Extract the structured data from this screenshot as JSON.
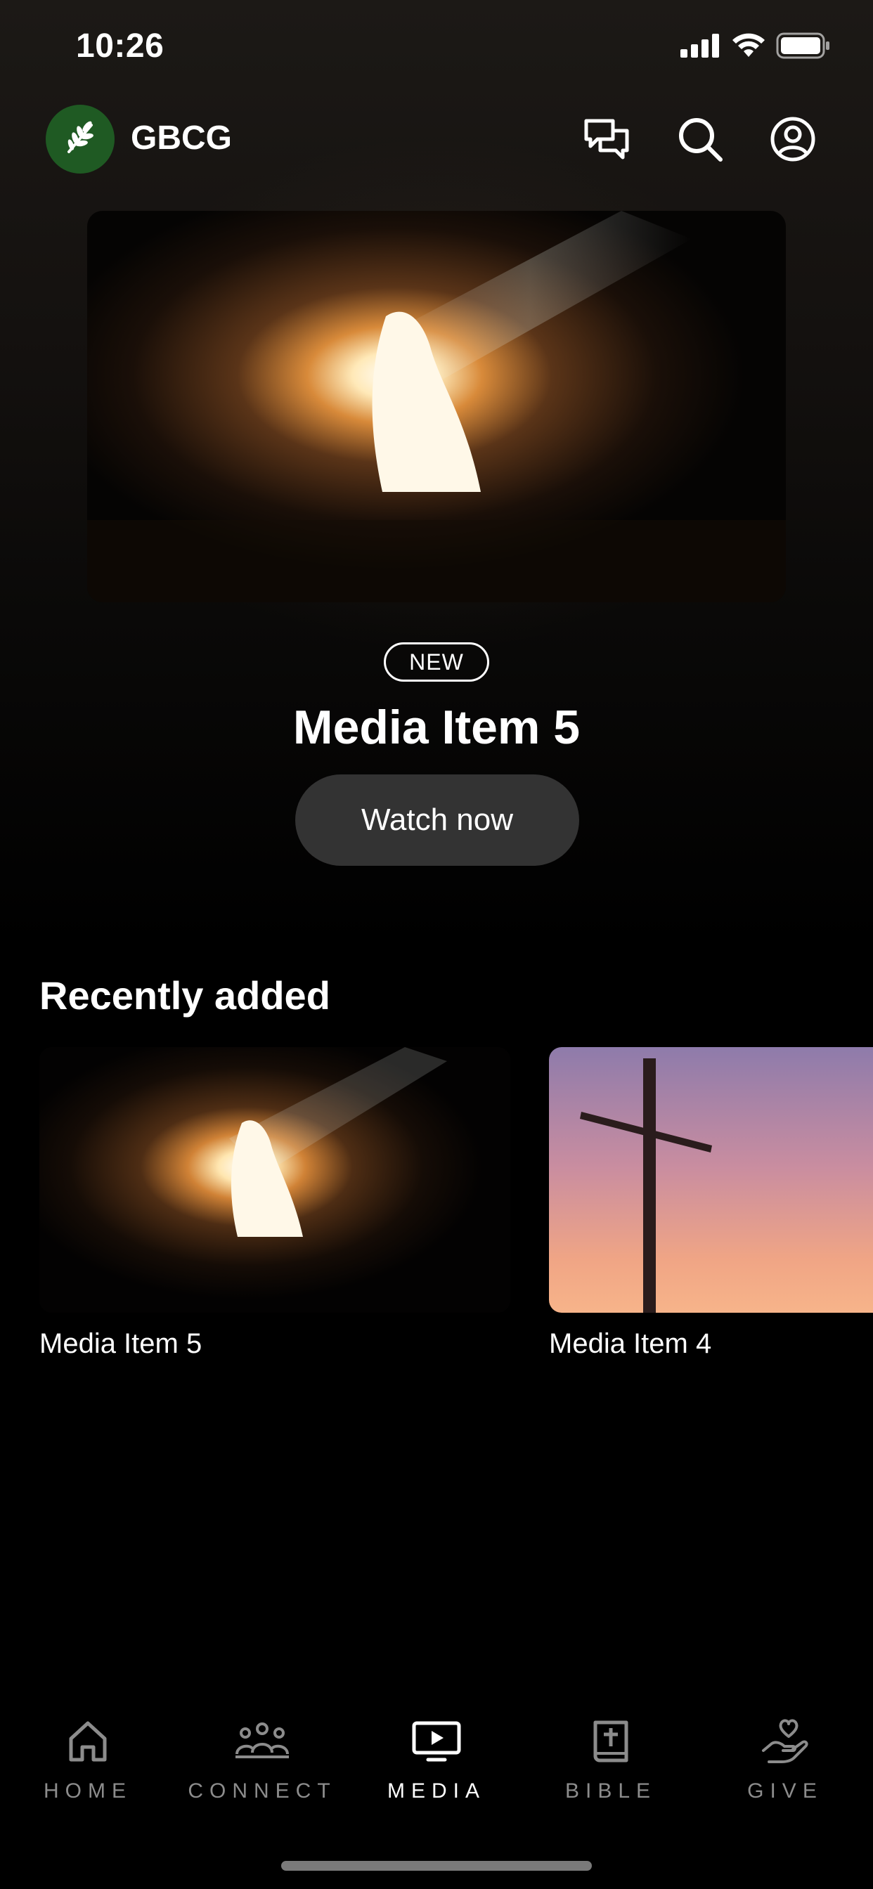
{
  "status_bar": {
    "time": "10:26",
    "icons": [
      "cellular-signal-icon",
      "wifi-icon",
      "battery-icon"
    ]
  },
  "header": {
    "church_name": "GBCG",
    "logo_icon": "wheat-icon",
    "logo_color": "#1f5a23",
    "actions": [
      "chat-icon",
      "search-icon",
      "profile-icon"
    ]
  },
  "hero": {
    "image": "empty-tomb-light-image",
    "badge": "NEW",
    "title": "Media Item 5",
    "button_label": "Watch now"
  },
  "recently_added": {
    "title": "Recently added",
    "items": [
      {
        "label": "Media Item 5",
        "image": "empty-tomb-light-image"
      },
      {
        "label": "Media Item 4",
        "image": "cross-sunset-sky-image"
      }
    ]
  },
  "tab_bar": {
    "active": "MEDIA",
    "tabs": [
      {
        "label": "HOME",
        "icon": "home-icon"
      },
      {
        "label": "CONNECT",
        "icon": "people-icon"
      },
      {
        "label": "MEDIA",
        "icon": "tv-play-icon"
      },
      {
        "label": "BIBLE",
        "icon": "bible-icon"
      },
      {
        "label": "GIVE",
        "icon": "heart-hand-icon"
      }
    ]
  },
  "colors": {
    "background": "#000000",
    "button_bg": "#333333",
    "tab_inactive": "#8c8c8c",
    "tab_active": "#ffffff"
  }
}
